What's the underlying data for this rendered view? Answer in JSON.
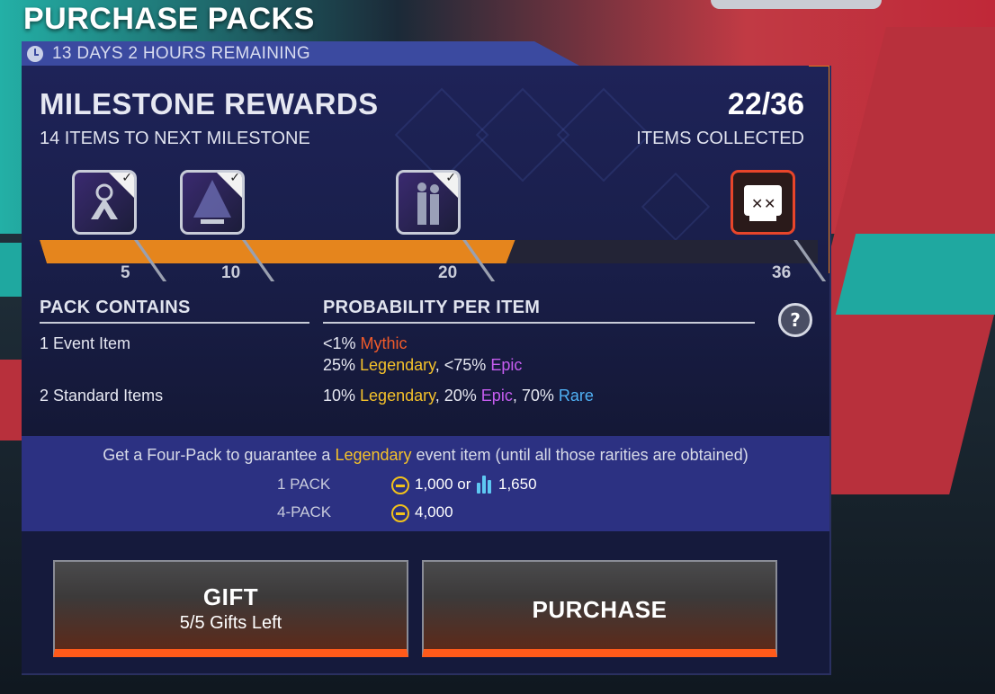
{
  "page_title": "PURCHASE PACKS",
  "timer": {
    "text": "13 DAYS 2 HOURS REMAINING"
  },
  "milestone": {
    "title": "MILESTONE REWARDS",
    "subtitle": "14 ITEMS TO NEXT MILESTONE",
    "count": "22/36",
    "count_label": "ITEMS COLLECTED",
    "progress_fraction": 0.611,
    "markers": [
      "5",
      "10",
      "20",
      "36"
    ],
    "rewards": [
      {
        "name": "apex-logo-badge",
        "claimed": true
      },
      {
        "name": "holo-tree-item",
        "claimed": true
      },
      {
        "name": "character-skin-item",
        "claimed": true
      },
      {
        "name": "skull-reward",
        "claimed": false
      }
    ]
  },
  "contents": {
    "header_left": "PACK CONTAINS",
    "header_right": "PROBABILITY PER ITEM",
    "row1_label": "1 Event Item",
    "row1_line1": {
      "pct": "<1% ",
      "rarity": "Mythic"
    },
    "row1_line2": {
      "pct1": "25% ",
      "r1": "Legendary",
      "sep": ", <75% ",
      "r2": "Epic"
    },
    "row2_label": "2 Standard Items",
    "row2_line": {
      "p1": "10% ",
      "r1": "Legendary",
      "p2": ", 20% ",
      "r2": "Epic",
      "p3": ", 70% ",
      "r3": "Rare"
    }
  },
  "guarantee": {
    "pre": "Get a Four-Pack to guarantee a ",
    "highlight": "Legendary",
    "post": " event item (until all those rarities are obtained)",
    "pack1_label": "1 PACK",
    "pack1_coins": "1,000 or",
    "pack1_crystals": "1,650",
    "pack4_label": "4-PACK",
    "pack4_coins": "4,000"
  },
  "buttons": {
    "gift_title": "GIFT",
    "gift_sub": "5/5 Gifts Left",
    "purchase_title": "PURCHASE"
  },
  "colors": {
    "mythic": "#ef5a2a",
    "legendary": "#f4c12a",
    "epic": "#c65df0",
    "rare": "#4fb0f4",
    "progress": "#e5851d",
    "accent": "#ff5a1a"
  }
}
